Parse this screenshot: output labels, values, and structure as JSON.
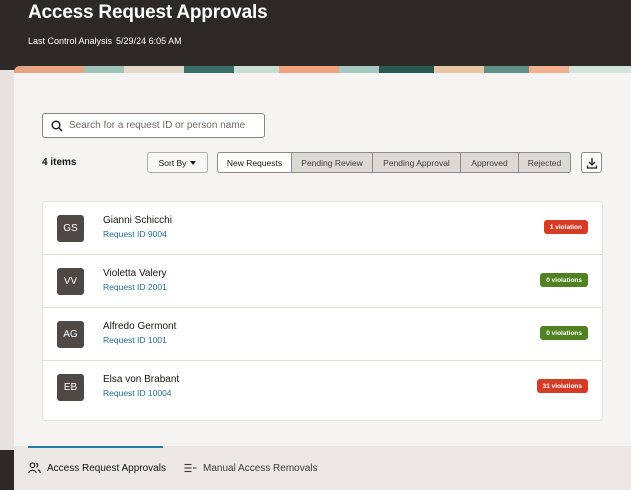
{
  "header": {
    "title": "Access Request Approvals",
    "last_control_label": "Last Control Analysis",
    "last_control_value": "5/29/24 6:05 AM"
  },
  "search": {
    "placeholder": "Search for a request ID or person name",
    "value": "",
    "icon": "search-icon"
  },
  "toolbar": {
    "items_count": "4 items",
    "sort_label": "Sort By",
    "filters": [
      "New Requests",
      "Pending Review",
      "Pending Approval",
      "Approved",
      "Rejected"
    ],
    "active_filter": "New Requests",
    "download_icon": "download-icon"
  },
  "requests": [
    {
      "initials": "GS",
      "name": "Gianni Schicchi",
      "request_id": "Request ID 9004",
      "violations": "1 violation",
      "status_color": "#d63b25"
    },
    {
      "initials": "VV",
      "name": "Violetta Valery",
      "request_id": "Request ID 2001",
      "violations": "0 violations",
      "status_color": "#508223"
    },
    {
      "initials": "AG",
      "name": "Alfredo Germont",
      "request_id": "Request ID 1001",
      "violations": "0 violations",
      "status_color": "#508223"
    },
    {
      "initials": "EB",
      "name": "Elsa von Brabant",
      "request_id": "Request ID 10004",
      "violations": "31 violations",
      "status_color": "#d63b25"
    }
  ],
  "bottom_tabs": [
    {
      "label": "Access Request Approvals",
      "icon": "users-icon",
      "active": true
    },
    {
      "label": "Manual Access Removals",
      "icon": "list-remove-icon",
      "active": false
    }
  ],
  "colors": {
    "header_bg": "#2c2926",
    "link": "#236f9b",
    "violation": "#d63b25",
    "ok": "#508223",
    "tab_indicator": "#227e9e"
  }
}
